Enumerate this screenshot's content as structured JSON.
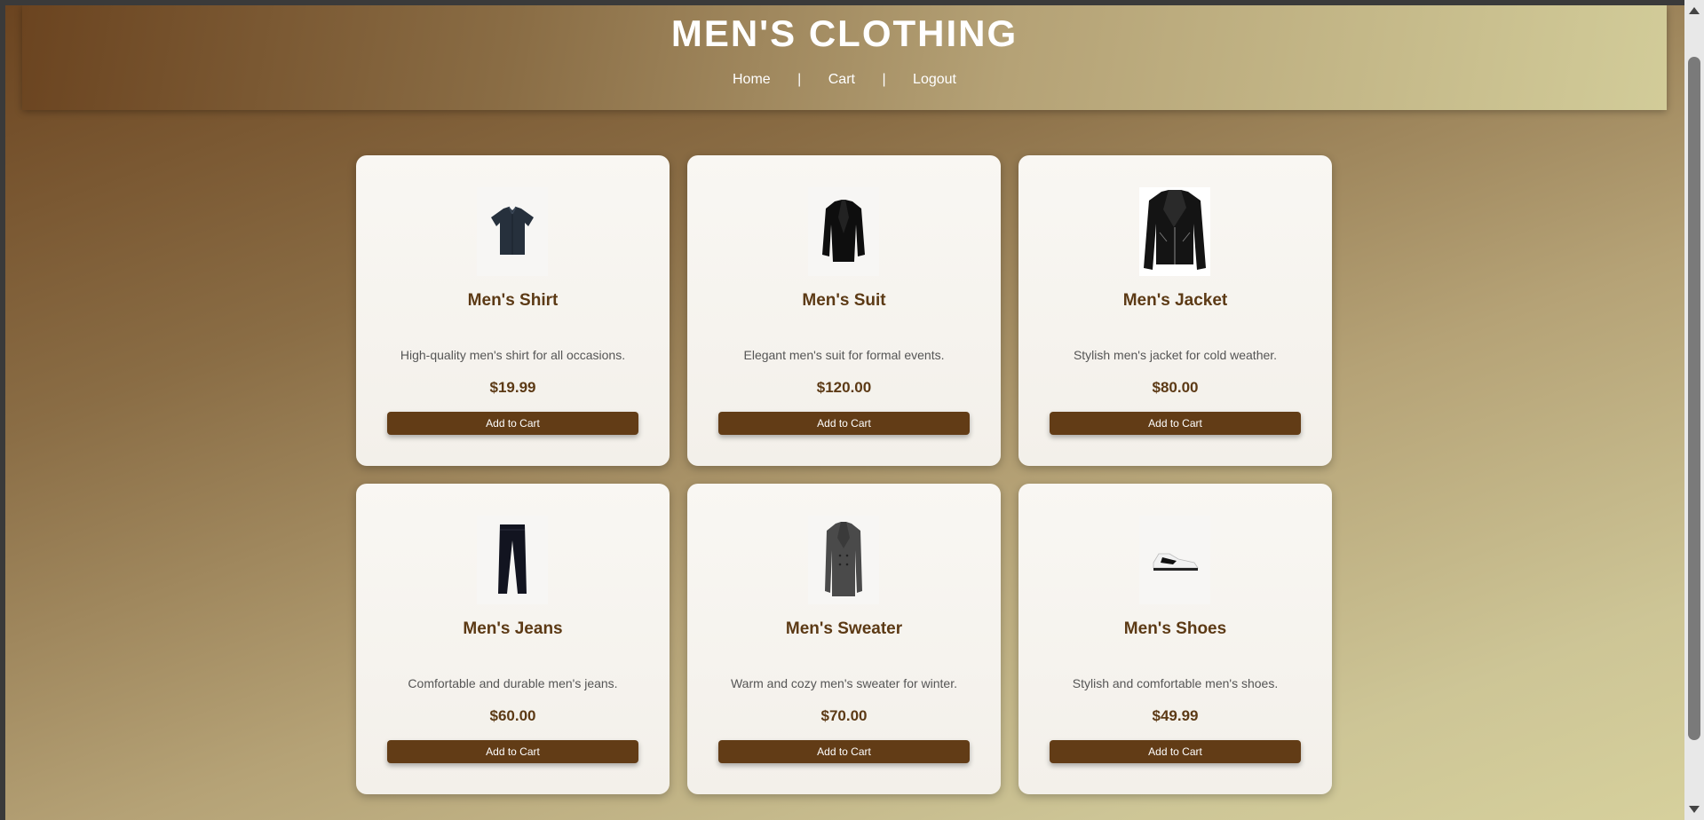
{
  "header": {
    "title": "MEN'S CLOTHING",
    "nav": {
      "home": "Home",
      "cart": "Cart",
      "logout": "Logout",
      "separator": "|"
    }
  },
  "products": [
    {
      "name": "Men's Shirt",
      "description": "High-quality men's shirt for all occasions.",
      "price": "$19.99",
      "button": "Add to Cart",
      "icon": "shirt-image"
    },
    {
      "name": "Men's Suit",
      "description": "Elegant men's suit for formal events.",
      "price": "$120.00",
      "button": "Add to Cart",
      "icon": "suit-image"
    },
    {
      "name": "Men's Jacket",
      "description": "Stylish men's jacket for cold weather.",
      "price": "$80.00",
      "button": "Add to Cart",
      "icon": "jacket-image"
    },
    {
      "name": "Men's Jeans",
      "description": "Comfortable and durable men's jeans.",
      "price": "$60.00",
      "button": "Add to Cart",
      "icon": "jeans-image"
    },
    {
      "name": "Men's Sweater",
      "description": "Warm and cozy men's sweater for winter.",
      "price": "$70.00",
      "button": "Add to Cart",
      "icon": "coat-image"
    },
    {
      "name": "Men's Shoes",
      "description": "Stylish and comfortable men's shoes.",
      "price": "$49.99",
      "button": "Add to Cart",
      "icon": "sneaker-image"
    }
  ],
  "colors": {
    "accent": "#623c16",
    "title_text": "#5c3a15"
  }
}
